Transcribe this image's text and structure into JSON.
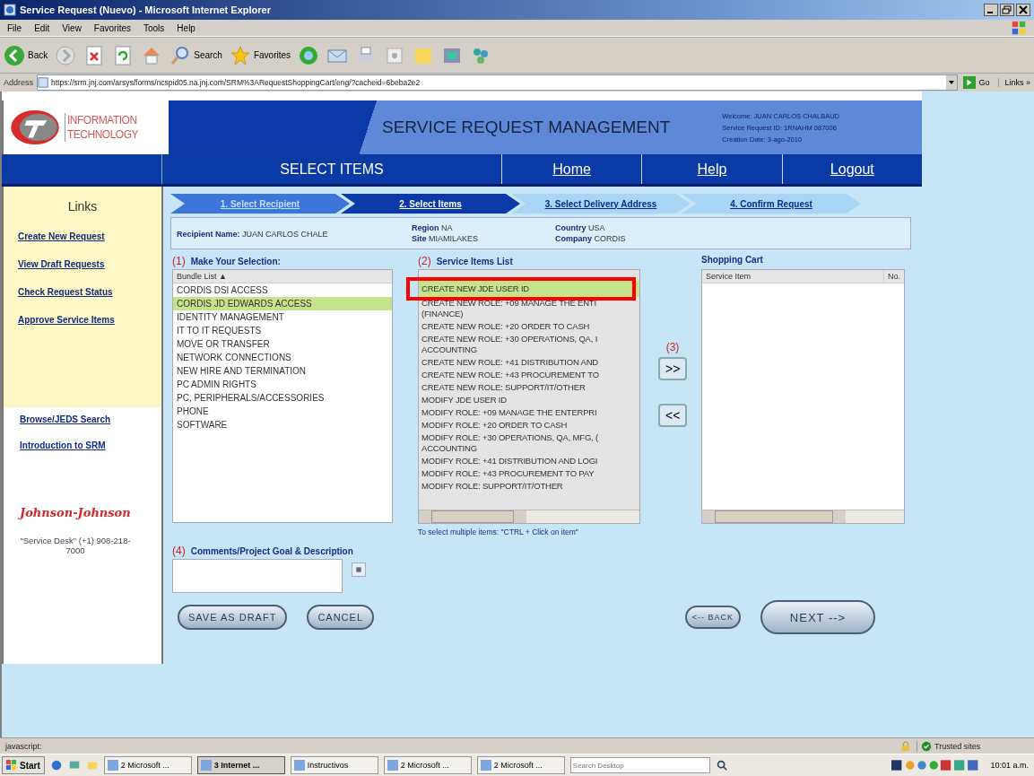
{
  "window": {
    "title": "Service Request (Nuevo) - Microsoft Internet Explorer"
  },
  "menu": [
    "File",
    "Edit",
    "View",
    "Favorites",
    "Tools",
    "Help"
  ],
  "toolbar": {
    "back": "Back",
    "search": "Search",
    "favorites": "Favorites"
  },
  "address": {
    "label": "Address",
    "url": "https://srm.jnj.com/arsys/forms/ncspid05.na.jnj.com/SRM%3ARequestShoppingCart/eng/?cacheid=6beba2e2",
    "go": "Go",
    "links": "Links »"
  },
  "header": {
    "logo_lines": [
      "INFORMATION",
      "TECHNOLOGY"
    ],
    "title": "SERVICE REQUEST MANAGEMENT",
    "info": [
      "Welcome: JUAN CARLOS CHALBAUD",
      "Service Request ID: 1RNAHM 087006",
      "Creation Date: 3-ago-2010"
    ]
  },
  "nav": {
    "section": "SELECT ITEMS",
    "links": [
      "Home",
      "Help",
      "Logout"
    ]
  },
  "sidebar": {
    "heading": "Links",
    "links": [
      "Create New Request",
      "View Draft Requests",
      "Check Request Status",
      "Approve Service Items"
    ],
    "links2": [
      "Browse/JEDS Search",
      "Introduction to SRM"
    ],
    "brand": "Johnson-Johnson",
    "contact": "\"Service Desk\" (+1) 908-218-7000"
  },
  "steps": [
    {
      "label": "1. Select Recipient",
      "done": true,
      "selected": false
    },
    {
      "label": "2. Select Items",
      "done": false,
      "selected": true
    },
    {
      "label": "3. Select Delivery Address",
      "done": false,
      "selected": false
    },
    {
      "label": "4. Confirm Request",
      "done": false,
      "selected": false
    }
  ],
  "recipient": {
    "name_label": "Recipient Name:",
    "name": "JUAN CARLOS CHALE",
    "region_label": "Region",
    "region": "NA",
    "site_label": "Site",
    "site": "MIAMILAKES",
    "country_label": "Country",
    "country": "USA",
    "company_label": "Company",
    "company": "CORDIS"
  },
  "selection": {
    "number": "(1)",
    "title": "Make Your Selection:",
    "header": "Bundle List ▲",
    "items": [
      {
        "text": "CORDIS DSI ACCESS",
        "selected": false
      },
      {
        "text": "CORDIS JD EDWARDS ACCESS",
        "selected": true
      },
      {
        "text": "IDENTITY MANAGEMENT",
        "selected": false
      },
      {
        "text": "IT TO IT REQUESTS",
        "selected": false
      },
      {
        "text": "MOVE OR TRANSFER",
        "selected": false
      },
      {
        "text": "NETWORK CONNECTIONS",
        "selected": false
      },
      {
        "text": "NEW HIRE AND TERMINATION",
        "selected": false
      },
      {
        "text": "PC ADMIN RIGHTS",
        "selected": false
      },
      {
        "text": "PC, PERIPHERALS/ACCESSORIES",
        "selected": false
      },
      {
        "text": "PHONE",
        "selected": false
      },
      {
        "text": "SOFTWARE",
        "selected": false
      }
    ]
  },
  "service_items": {
    "number": "(2)",
    "title": "Service Items List",
    "items": [
      {
        "lines": [
          "CREATE NEW JDE USER ID"
        ],
        "selected": true
      },
      {
        "lines": [
          "CREATE NEW ROLE: +09 MANAGE THE ENTI",
          "(FINANCE)"
        ],
        "selected": false
      },
      {
        "lines": [
          "CREATE NEW ROLE: +20 ORDER TO CASH"
        ],
        "selected": false
      },
      {
        "lines": [
          "CREATE NEW ROLE: +30 OPERATIONS, QA, I",
          "ACCOUNTING"
        ],
        "selected": false
      },
      {
        "lines": [
          "CREATE NEW ROLE: +41 DISTRIBUTION AND"
        ],
        "selected": false
      },
      {
        "lines": [
          "CREATE NEW ROLE: +43 PROCUREMENT TO"
        ],
        "selected": false
      },
      {
        "lines": [
          "CREATE NEW ROLE: SUPPORT/IT/OTHER"
        ],
        "selected": false
      },
      {
        "lines": [
          "MODIFY JDE USER ID"
        ],
        "selected": false
      },
      {
        "lines": [
          "MODIFY ROLE: +09 MANAGE THE ENTERPRI"
        ],
        "selected": false
      },
      {
        "lines": [
          "MODIFY ROLE: +20 ORDER TO CASH"
        ],
        "selected": false
      },
      {
        "lines": [
          "MODIFY ROLE: +30 OPERATIONS, QA, MFG, (",
          "ACCOUNTING"
        ],
        "selected": false
      },
      {
        "lines": [
          "MODIFY ROLE: +41 DISTRIBUTION AND LOGI"
        ],
        "selected": false
      },
      {
        "lines": [
          "MODIFY ROLE: +43 PROCUREMENT TO PAY"
        ],
        "selected": false
      },
      {
        "lines": [
          "MODIFY ROLE: SUPPORT/IT/OTHER"
        ],
        "selected": false
      }
    ],
    "hint": "To select multiple items: \"CTRL + Click on item\""
  },
  "transfer": {
    "number": "(3)",
    "add": ">>",
    "remove": "<<"
  },
  "cart": {
    "title": "Shopping Cart",
    "columns": [
      "Service Item",
      "No."
    ]
  },
  "comments": {
    "number": "(4)",
    "title": "Comments/Project Goal & Description"
  },
  "buttons": {
    "save": "SAVE AS DRAFT",
    "cancel": "CANCEL",
    "back": "<-- BACK",
    "next": "NEXT -->"
  },
  "status_bar": {
    "text": "javascript:",
    "zone": "Trusted sites"
  },
  "taskbar": {
    "start": "Start",
    "items": [
      {
        "label": "2 Microsoft ...",
        "selected": false
      },
      {
        "label": "3 Internet ...",
        "selected": true
      },
      {
        "label": "Instructivos",
        "selected": false
      },
      {
        "label": "2 Microsoft ...",
        "selected": false
      },
      {
        "label": "2 Microsoft ...",
        "selected": false
      }
    ],
    "search_placeholder": "Search Desktop",
    "clock": "10:01 a.m."
  }
}
